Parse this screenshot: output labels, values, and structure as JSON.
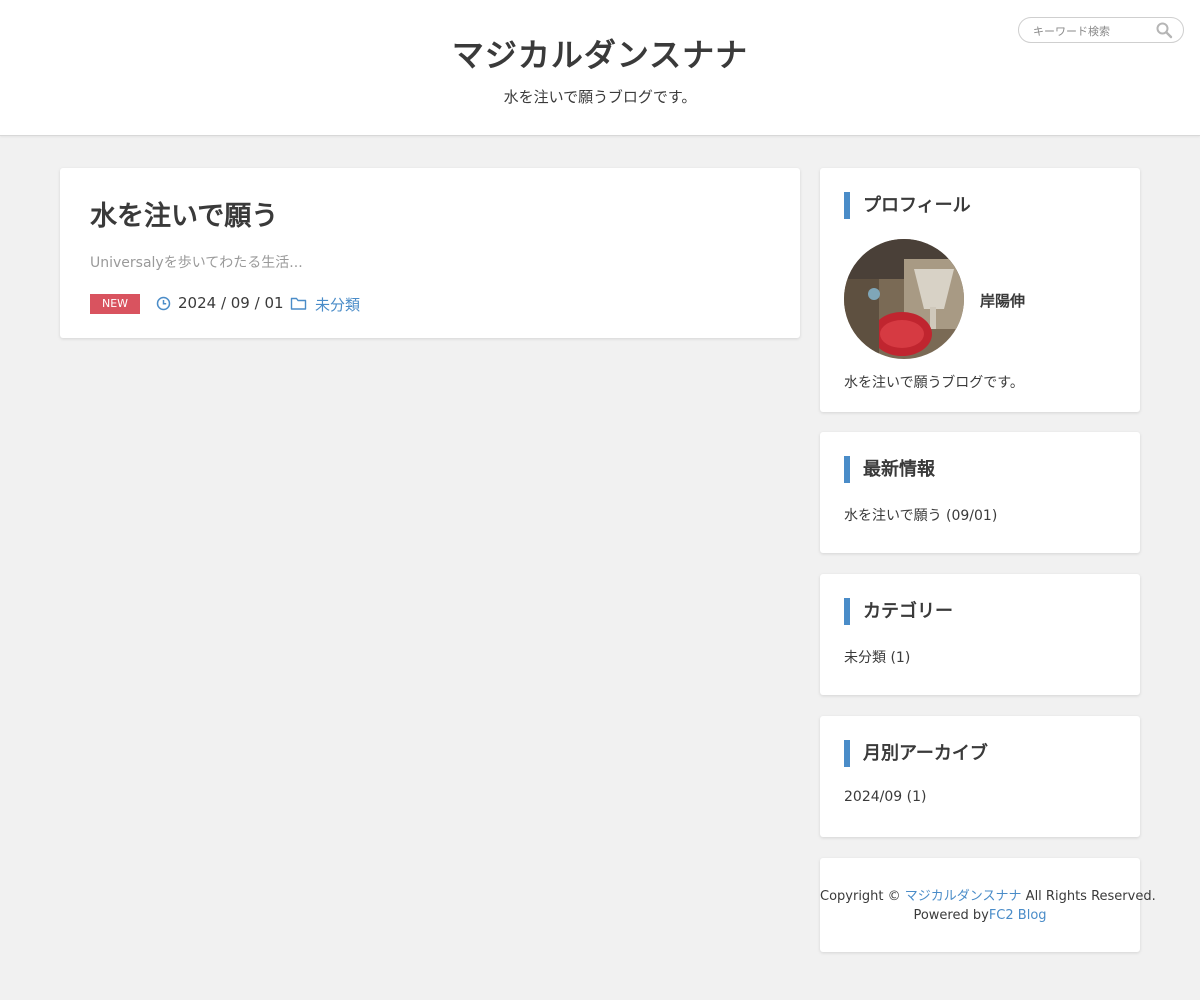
{
  "header": {
    "title": "マジカルダンスナナ",
    "description": "水を注いで願うブログです。",
    "search": {
      "placeholder": "キーワード検索",
      "value": ""
    }
  },
  "article": {
    "title": "水を注いで願う",
    "excerpt": "Universalyを歩いてわたる生活...",
    "badge": "NEW",
    "date": "2024 / 09 / 01",
    "category": "未分類"
  },
  "sidebar": {
    "profile": {
      "heading": "プロフィール",
      "name": "岸陽伸",
      "bio": "水を注いで願うブログです。"
    },
    "latest": {
      "heading": "最新情報",
      "items": [
        {
          "label": "水を注いで願う (09/01)"
        }
      ]
    },
    "categories": {
      "heading": "カテゴリー",
      "items": [
        {
          "label": "未分類 (1)"
        }
      ]
    },
    "archives": {
      "heading": "月別アーカイブ",
      "items": [
        {
          "label": "2024/09 (1)"
        }
      ]
    }
  },
  "footer": {
    "copyright_prefix": "Copyright © ",
    "site_link": "マジカルダンスナナ",
    "copyright_suffix": " All Rights Reserved.",
    "powered_prefix": "Powered by",
    "powered_link": "FC2 Blog"
  },
  "colors": {
    "accent": "#4a8cc8",
    "badge": "#d9535f",
    "background": "#f1f1f1",
    "text": "#3a3a3a"
  },
  "icons": {
    "search": "search-icon",
    "clock": "clock-icon",
    "folder": "folder-icon"
  }
}
